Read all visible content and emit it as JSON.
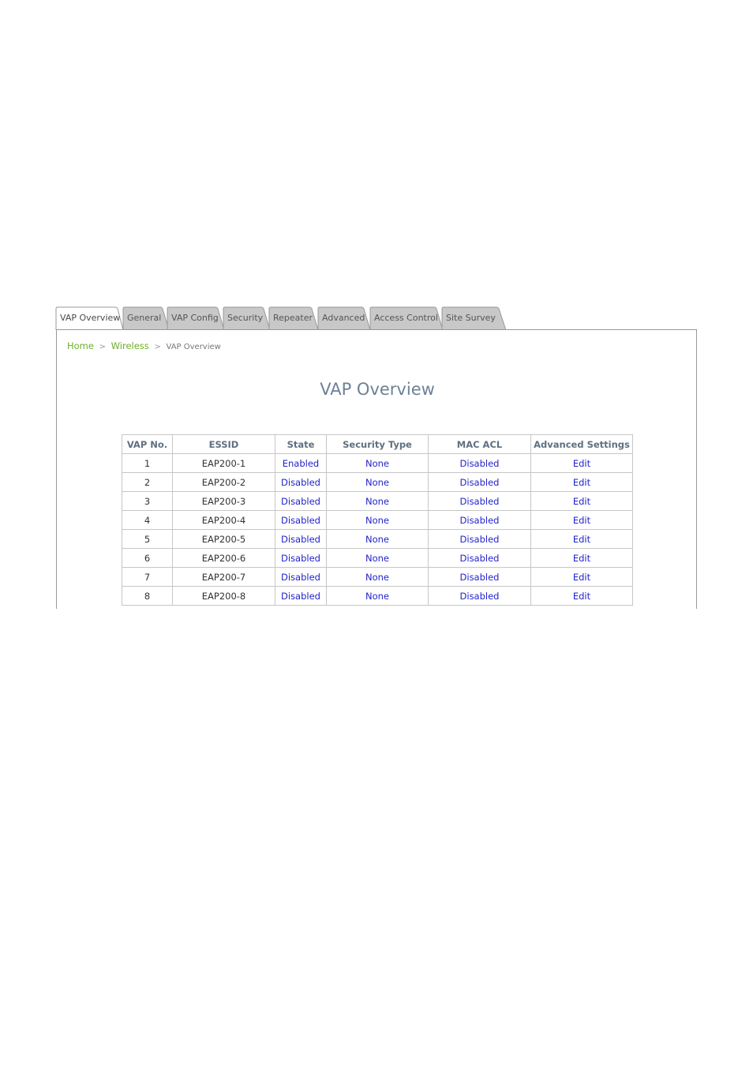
{
  "tabs": [
    {
      "label": "VAP Overview",
      "active": true
    },
    {
      "label": "General"
    },
    {
      "label": "VAP Config"
    },
    {
      "label": "Security"
    },
    {
      "label": "Repeater"
    },
    {
      "label": "Advanced"
    },
    {
      "label": "Access Control"
    },
    {
      "label": "Site Survey"
    }
  ],
  "breadcrumb": {
    "home": "Home",
    "sep1": ">",
    "wireless": "Wireless",
    "sep2": ">",
    "current": "VAP Overview"
  },
  "page_title": "VAP Overview",
  "table": {
    "headers": [
      "VAP No.",
      "ESSID",
      "State",
      "Security Type",
      "MAC ACL",
      "Advanced Settings"
    ],
    "rows": [
      [
        "1",
        "EAP200-1",
        "Enabled",
        "None",
        "Disabled",
        "Edit"
      ],
      [
        "2",
        "EAP200-2",
        "Disabled",
        "None",
        "Disabled",
        "Edit"
      ],
      [
        "3",
        "EAP200-3",
        "Disabled",
        "None",
        "Disabled",
        "Edit"
      ],
      [
        "4",
        "EAP200-4",
        "Disabled",
        "None",
        "Disabled",
        "Edit"
      ],
      [
        "5",
        "EAP200-5",
        "Disabled",
        "None",
        "Disabled",
        "Edit"
      ],
      [
        "6",
        "EAP200-6",
        "Disabled",
        "None",
        "Disabled",
        "Edit"
      ],
      [
        "7",
        "EAP200-7",
        "Disabled",
        "None",
        "Disabled",
        "Edit"
      ],
      [
        "8",
        "EAP200-8",
        "Disabled",
        "None",
        "Disabled",
        "Edit"
      ]
    ]
  },
  "colors": {
    "link_green": "#6fae2b",
    "link_blue": "#2222cc",
    "title": "#6d8196",
    "tab_inactive": "#c8c8c8",
    "tab_active": "#ffffff"
  }
}
